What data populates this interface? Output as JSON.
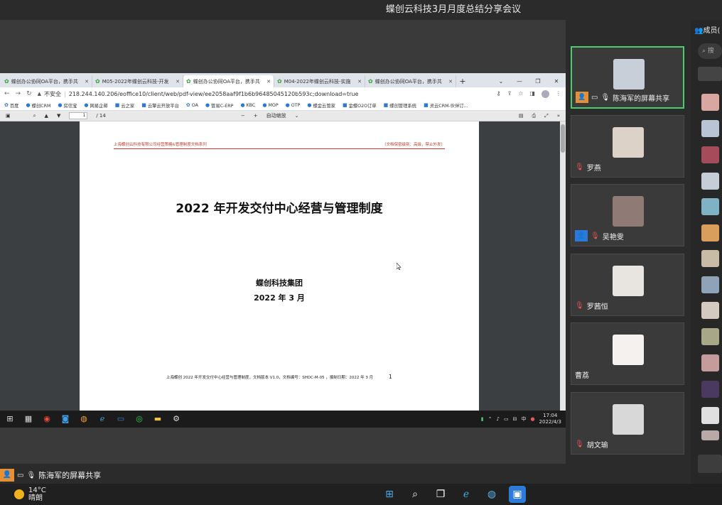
{
  "meeting": {
    "title": "蝶创云科技3月月度总结分享会议"
  },
  "browser": {
    "tabs": [
      {
        "label": "蝶创办公协同OA平台，携手共",
        "active": false
      },
      {
        "label": "M05-2022年蝶创云科技-开发",
        "active": false
      },
      {
        "label": "蝶创办公协同OA平台，携手共",
        "active": true
      },
      {
        "label": "M04-2022年蝶创云科技-实施",
        "active": false
      },
      {
        "label": "蝶创办公协同OA平台，携手共",
        "active": false
      }
    ],
    "security_label": "不安全",
    "url": "218.244.140.206/eoffice10/client/web/pdf-view/ee2058aaf9f1b6b96485045120b593c;download=true",
    "bookmarks": [
      "百度",
      "蝶创CRM",
      "房信宝",
      "网易企邮",
      "云之家",
      "云擎云开放平台",
      "OA",
      "管易C-ERP",
      "KBC",
      "MOP",
      "OTP",
      "蝶金云管家",
      "金蝶O2O订单",
      "蝶创管理系统",
      "灵云CRM-伙伴订..."
    ]
  },
  "pdf": {
    "page_current": "1",
    "page_total": "/ 14",
    "zoom_label": "自动缩放",
    "header_left": "上海蝶创云科技有限公司经营策略&管理制度文档系列",
    "header_right": "（文档保密级别：高级，禁止外发）",
    "title": "2022 年开发交付中心经营与管理制度",
    "org": "蝶创科技集团",
    "date": "2022 年 3 月",
    "footer_text": "上海蝶创 2022 年开发交付中心经营与管理制度，文档版本 V1.0，文档编号：SHDC-M-05 ，撰制日期：2022 年 3 月",
    "page_number": "1"
  },
  "inner_taskbar": {
    "lang": "中",
    "time": "17:04",
    "date": "2022/4/3"
  },
  "presenter_label": "陈海军的屏幕共享",
  "participants": [
    {
      "name": "陈海军的屏幕共享",
      "active": true,
      "badge_color": "#e69036",
      "pic_color": "#c9cfd8"
    },
    {
      "name": "罗燕",
      "active": false,
      "badge_color": "",
      "pic_color": "#ddd2c8"
    },
    {
      "name": "吴艳雯",
      "active": false,
      "badge_color": "#2a7ad8",
      "pic_color": "#8f7a75"
    },
    {
      "name": "罗茜恒",
      "active": false,
      "badge_color": "",
      "pic_color": "#e8e4e0"
    },
    {
      "name": "曹荔",
      "active": false,
      "badge_color": "",
      "pic_color": "#f4f1ee"
    },
    {
      "name": "胡文瑜",
      "active": false,
      "badge_color": "",
      "pic_color": "#d8d8d8"
    }
  ],
  "members": {
    "header": "成员(",
    "search_placeholder": "搜",
    "avatar_colors": [
      "#d9a6a0",
      "#b9c4d4",
      "#a44c5a",
      "#c7cdd6",
      "#7fb2c5",
      "#d99e5c",
      "#c8bca6",
      "#8fa3b8",
      "#d3cbc2",
      "#a8a888",
      "#c49c9c",
      "#4a3a60",
      "#e0e0e0",
      "#b8a8a8"
    ]
  },
  "os_taskbar": {
    "temperature": "14°C",
    "weather": "晴朗"
  }
}
